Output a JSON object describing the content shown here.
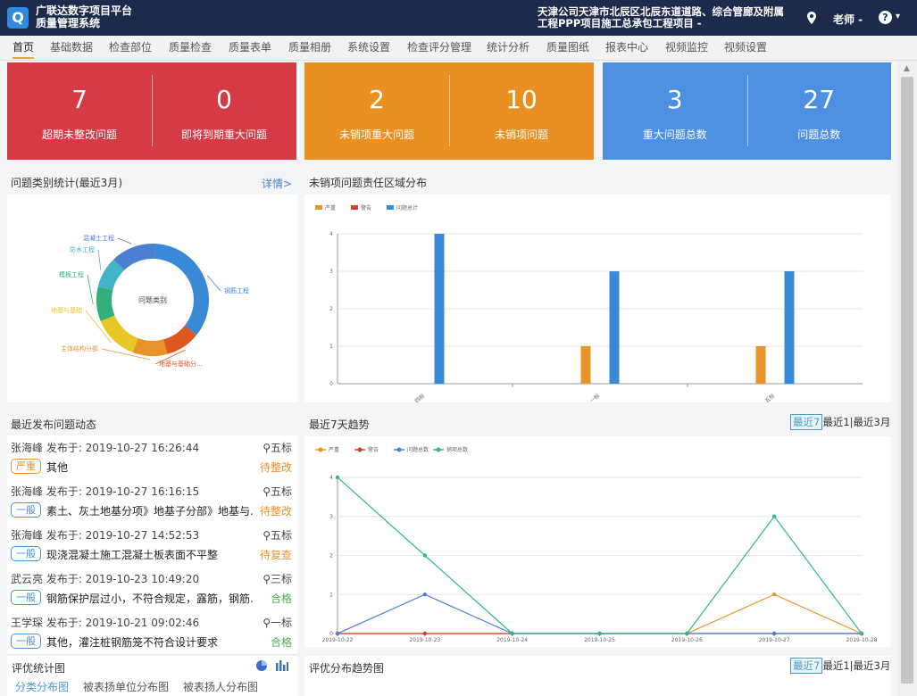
{
  "header": {
    "logo_letter": "Q",
    "brand_line1": "广联达数字项目平台",
    "brand_line2": "质量管理系统",
    "project_line1": "天津公司天津市北辰区北辰东道道路、综合管廊及附属",
    "project_line2": "工程PPP项目施工总承包工程项目 -",
    "user": "老师 -",
    "help": "?",
    "help_caret": "▾",
    "location_icon": "map-pin-icon"
  },
  "nav": [
    "首页",
    "基础数据",
    "检查部位",
    "质量检查",
    "质量表单",
    "质量相册",
    "系统设置",
    "检查评分管理",
    "统计分析",
    "质量图纸",
    "报表中心",
    "视频监控",
    "视频设置"
  ],
  "kpis": [
    {
      "color": "#d63a45",
      "items": [
        {
          "value": "7",
          "label": "超期未整改问题"
        },
        {
          "value": "0",
          "label": "即将到期重大问题"
        }
      ]
    },
    {
      "color": "#ea8f22",
      "items": [
        {
          "value": "2",
          "label": "未销项重大问题"
        },
        {
          "value": "10",
          "label": "未销项问题"
        }
      ]
    },
    {
      "color": "#4d8fe0",
      "items": [
        {
          "value": "3",
          "label": "重大问题总数"
        },
        {
          "value": "27",
          "label": "问题总数"
        }
      ]
    }
  ],
  "category": {
    "title": "问题类别统计(最近3月)",
    "more": "详情>",
    "center": "问题类别",
    "chart_data": {
      "type": "pie",
      "slices": [
        {
          "label": "钢筋工程",
          "value": 35,
          "color": "#3a88d8"
        },
        {
          "label": "地基与基础分...",
          "value": 10,
          "color": "#e0561f"
        },
        {
          "label": "主体结构分部",
          "value": 10,
          "color": "#e8932a"
        },
        {
          "label": "地基与基础",
          "value": 13,
          "color": "#e8c623"
        },
        {
          "label": "模板工程",
          "value": 10,
          "color": "#33b07a"
        },
        {
          "label": "防水工程",
          "value": 9,
          "color": "#42b4c7"
        },
        {
          "label": "混凝土工程",
          "value": 13,
          "color": "#4a7fd2"
        }
      ]
    }
  },
  "zone": {
    "title": "未销项问题责任区域分布",
    "chart_data": {
      "type": "bar",
      "categories": [
        "四标",
        "一标",
        "五标"
      ],
      "series": [
        {
          "name": "严重",
          "color": "#e8932a",
          "values": [
            0,
            1,
            1
          ]
        },
        {
          "name": "警告",
          "color": "#d0402c",
          "values": [
            0,
            0,
            0
          ]
        },
        {
          "name": "问题总计",
          "color": "#3a88d8",
          "values": [
            4,
            3,
            3
          ]
        }
      ],
      "ylim": [
        0,
        4
      ],
      "yticks": [
        0,
        1,
        2,
        3,
        4
      ]
    }
  },
  "feed": {
    "title": "最近发布问题动态",
    "items": [
      {
        "meta": "张海峰 发布于: 2019-10-27 16:26:44",
        "loc": "五标",
        "tag": "严重",
        "tag_color": "#e8932a",
        "desc": "其他",
        "status": "待整改",
        "status_color": "#e8932a"
      },
      {
        "meta": "张海峰 发布于: 2019-10-27 16:16:15",
        "loc": "五标",
        "tag": "一般",
        "tag_color": "#4b8fd0",
        "desc": "素土、灰土地基分项》地基子分部》地基与...",
        "status": "待整改",
        "status_color": "#e8932a"
      },
      {
        "meta": "张海峰 发布于: 2019-10-27 14:52:53",
        "loc": "五标",
        "tag": "一般",
        "tag_color": "#4b8fd0",
        "desc": "现浇混凝土施工混凝土板表面不平整",
        "status": "待复查",
        "status_color": "#e8932a"
      },
      {
        "meta": "武云亮 发布于: 2019-10-23 10:49:20",
        "loc": "三标",
        "tag": "一般",
        "tag_color": "#4b8fd0",
        "desc": "钢筋保护层过小，不符合规定，露筋，钢筋...",
        "status": "合格",
        "status_color": "#4caf50"
      },
      {
        "meta": "王学琛 发布于: 2019-10-21 09:02:46",
        "loc": "一标",
        "tag": "一般",
        "tag_color": "#4b8fd0",
        "desc": "其他，灌注桩钢筋笼不符合设计要求",
        "status": "合格",
        "status_color": "#4caf50"
      }
    ]
  },
  "trend": {
    "title": "最近7天趋势",
    "ranges": [
      "最近7",
      "最近1|",
      "最近3月"
    ],
    "chart_data": {
      "type": "line",
      "x": [
        "2019-10-22",
        "2019-10-23",
        "2019-10-24",
        "2019-10-25",
        "2019-10-26",
        "2019-10-27",
        "2019-10-28"
      ],
      "series": [
        {
          "name": "严重",
          "color": "#e8932a",
          "values": [
            0,
            0,
            0,
            0,
            0,
            1,
            0
          ]
        },
        {
          "name": "警告",
          "color": "#d0402c",
          "values": [
            0,
            0,
            0,
            0,
            0,
            0,
            0
          ]
        },
        {
          "name": "问题总数",
          "color": "#4a7fd2",
          "values": [
            0,
            1,
            0,
            0,
            0,
            0,
            0
          ]
        },
        {
          "name": "销项总数",
          "color": "#2fb88a",
          "values": [
            4,
            2,
            0,
            0,
            0,
            3,
            0
          ]
        }
      ],
      "ylim": [
        0,
        4
      ],
      "yticks": [
        0,
        1,
        2,
        3,
        4
      ]
    }
  },
  "eval": {
    "title": "评优统计图",
    "tabs": [
      "分类分布图",
      "被表扬单位分布图",
      "被表扬人分布图"
    ],
    "pie_icon": "pie-chart-icon",
    "bar_icon": "bar-chart-icon"
  },
  "eval_trend": {
    "title": "评优分布趋势图",
    "ranges": [
      "最近7",
      "最近1|",
      "最近3月"
    ]
  }
}
